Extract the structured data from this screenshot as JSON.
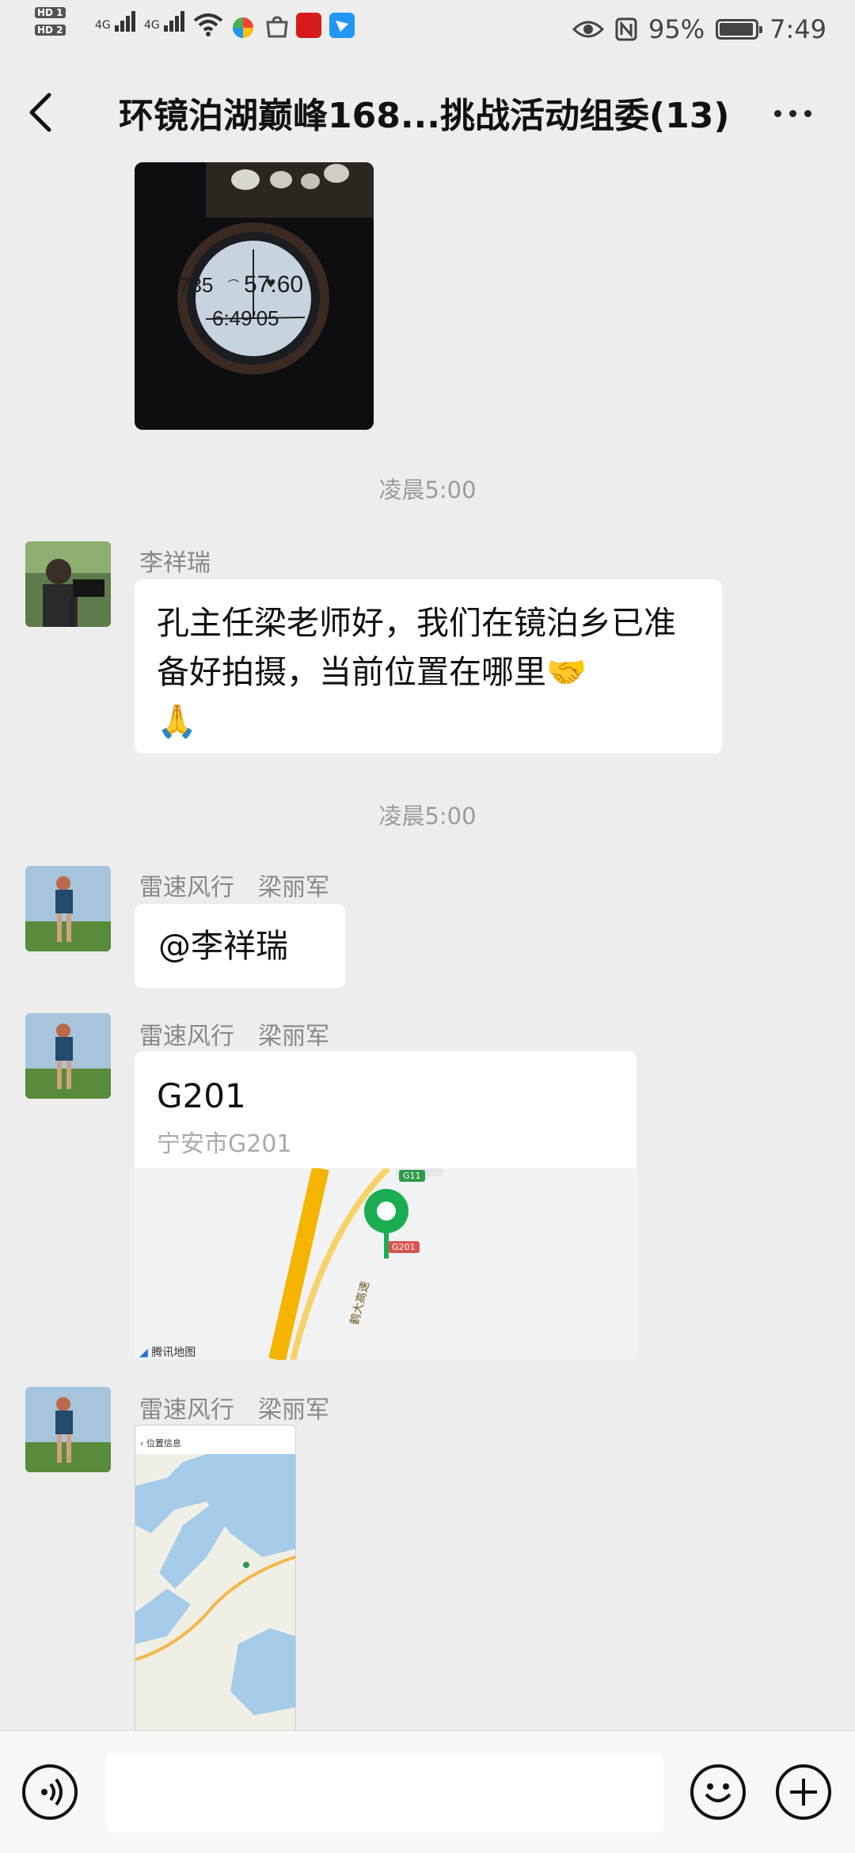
{
  "status_bar": {
    "hd1": "HD 1",
    "hd2": "HD 2",
    "net1": "4G",
    "net2": "4G",
    "battery_percent": "95%",
    "time": "7:49",
    "battery_level": 0.95
  },
  "header": {
    "title": "环镜泊湖巅峰168...挑战活动组委(13)"
  },
  "messages": {
    "watch_photo": {
      "value1": "735",
      "value2": "57.60",
      "value3": "6:49'05"
    },
    "time1": "凌晨5:00",
    "msg1": {
      "sender": "李祥瑞",
      "text": "孔主任梁老师好，我们在镜泊乡已准备好拍摄，当前位置在哪里",
      "emoji1": "🤝",
      "emoji2": "🙏"
    },
    "time2": "凌晨5:00",
    "msg2": {
      "sender": "雷速风行　梁丽军",
      "text": "@李祥瑞"
    },
    "msg3": {
      "sender": "雷速风行　梁丽军",
      "location_title": "G201",
      "location_subtitle": "宁安市G201",
      "map_road_g11": "G11",
      "map_road_g201": "G201",
      "map_road_name": "鹤大高速",
      "map_attribution": "腾讯地图"
    },
    "msg4": {
      "sender": "雷速风行　梁丽军",
      "screenshot_header": "位置信息"
    }
  },
  "colors": {
    "background": "#ededed",
    "bubble": "#ffffff",
    "pin": "#1aad52",
    "road": "#f5b400"
  }
}
